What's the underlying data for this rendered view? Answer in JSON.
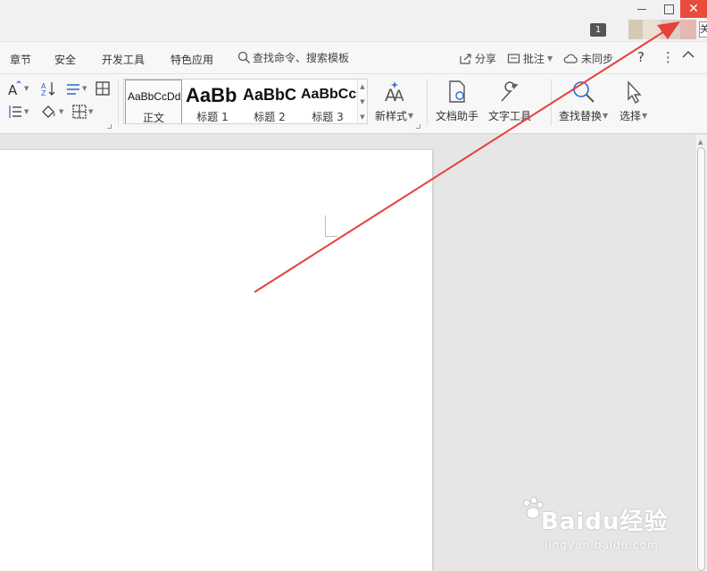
{
  "window": {
    "minimize_icon": "minimize-icon",
    "maximize_icon": "maximize-icon",
    "close_symbol": "✕",
    "close_tooltip": "关",
    "badge": "1",
    "avatar_colors": [
      "#d4c9b4",
      "#e8e0d4",
      "#d9cfc9",
      "#e6b8b4"
    ]
  },
  "menu": {
    "tabs": [
      "章节",
      "安全",
      "开发工具",
      "特色应用"
    ],
    "search": "查找命令、搜索模板",
    "share": "分享",
    "review": "批注",
    "sync": "未同步",
    "help": "?",
    "more": "⋮",
    "collapse": "^"
  },
  "ribbon": {
    "styles": [
      {
        "sample": "AaBbCcDd",
        "name": "正文"
      },
      {
        "sample": "AaBb",
        "name": "标题 1"
      },
      {
        "sample": "AaBbC",
        "name": "标题 2"
      },
      {
        "sample": "AaBbCc",
        "name": "标题 3"
      }
    ],
    "new_style": "新样式",
    "doc_assistant": "文档助手",
    "text_tools": "文字工具",
    "find_replace": "查找替换",
    "select": "选择"
  },
  "watermark": {
    "brand": "Baidu经验",
    "url": "jingyan.baidu.com"
  },
  "colors": {
    "accent_blue": "#2a6cc7",
    "close_red": "#e84c3d",
    "arrow_red": "#e8403a"
  }
}
